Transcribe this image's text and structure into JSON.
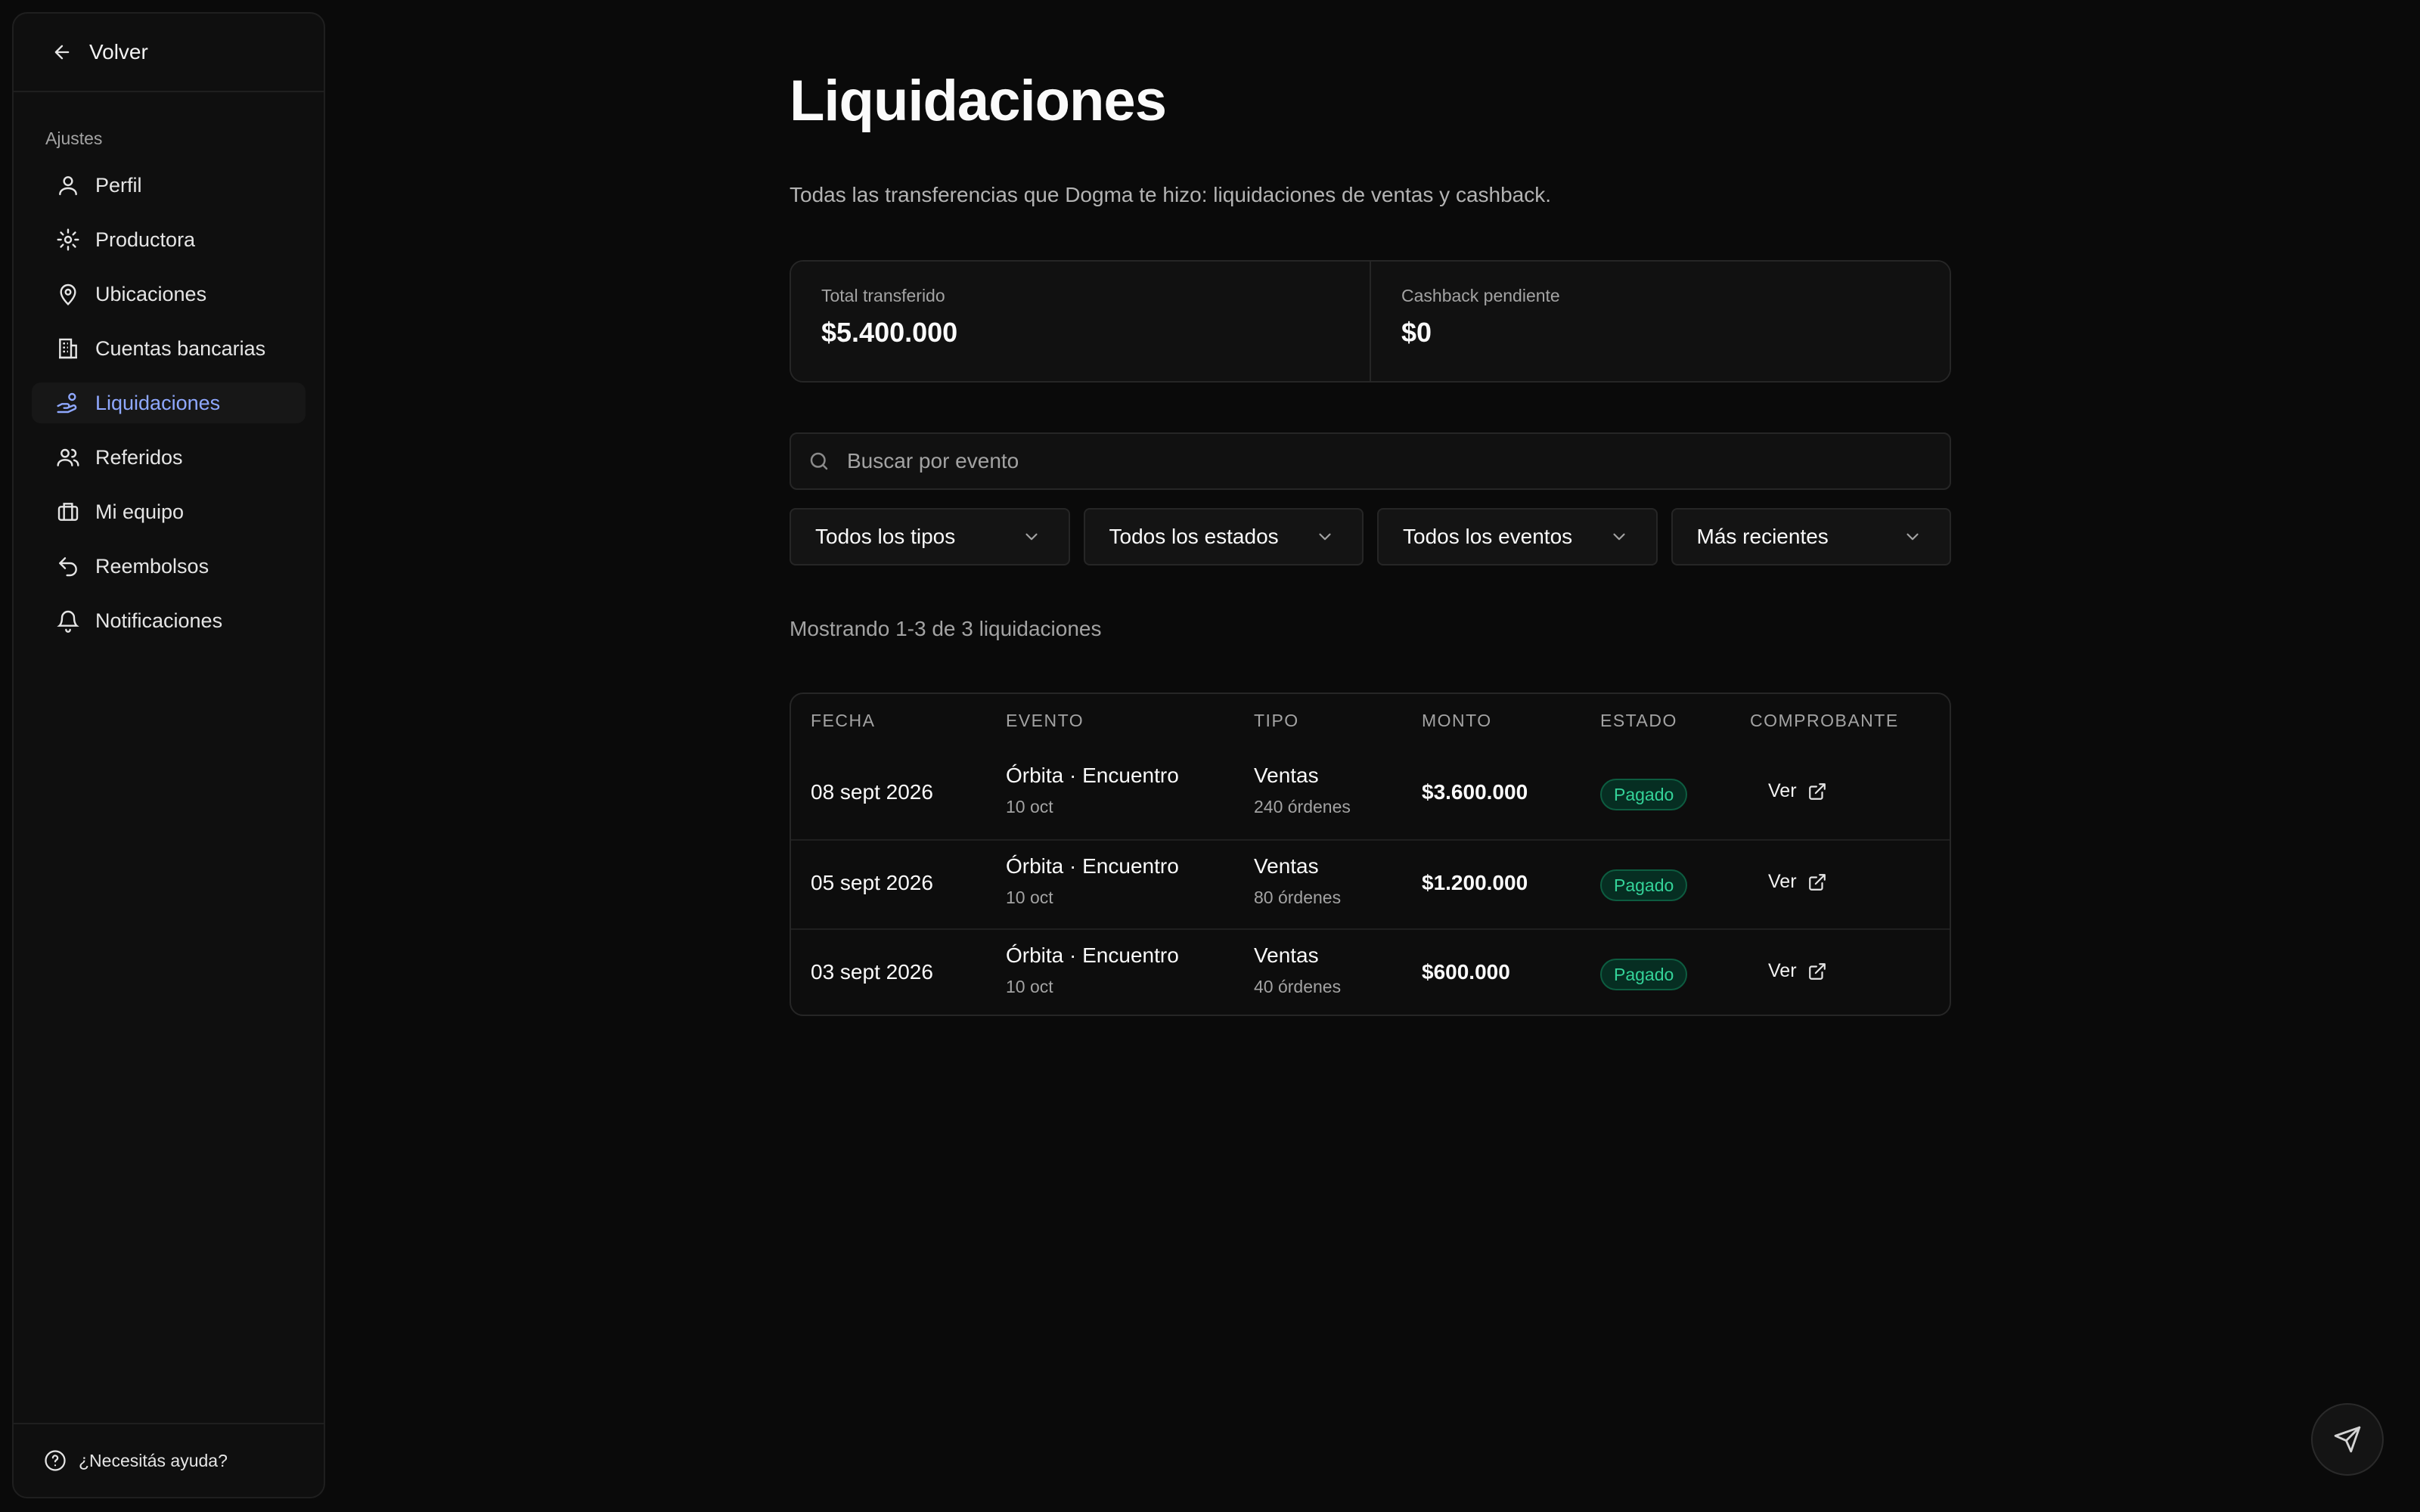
{
  "sidebar": {
    "back_label": "Volver",
    "section_label": "Ajustes",
    "items": [
      {
        "label": "Perfil"
      },
      {
        "label": "Productora"
      },
      {
        "label": "Ubicaciones"
      },
      {
        "label": "Cuentas bancarias"
      },
      {
        "label": "Liquidaciones",
        "active": true
      },
      {
        "label": "Referidos"
      },
      {
        "label": "Mi equipo"
      },
      {
        "label": "Reembolsos"
      },
      {
        "label": "Notificaciones"
      }
    ],
    "help_label": "¿Necesitás ayuda?"
  },
  "page": {
    "title": "Liquidaciones",
    "subtitle": "Todas las transferencias que Dogma te hizo: liquidaciones de ventas y cashback."
  },
  "stats": [
    {
      "label": "Total transferido",
      "value": "$5.400.000"
    },
    {
      "label": "Cashback pendiente",
      "value": "$0"
    }
  ],
  "search": {
    "placeholder": "Buscar por evento"
  },
  "filters": [
    {
      "label": "Todos los tipos"
    },
    {
      "label": "Todos los estados"
    },
    {
      "label": "Todos los eventos"
    },
    {
      "label": "Más recientes"
    }
  ],
  "results_count": "Mostrando 1-3 de 3 liquidaciones",
  "table": {
    "headers": [
      "FECHA",
      "EVENTO",
      "TIPO",
      "MONTO",
      "ESTADO",
      "COMPROBANTE"
    ],
    "rows": [
      {
        "date": "08 sept 2026",
        "event": "Órbita · Encuentro",
        "event_date": "10 oct",
        "type": "Ventas",
        "orders": "240 órdenes",
        "amount": "$3.600.000",
        "status": "Pagado",
        "receipt": "Ver"
      },
      {
        "date": "05 sept 2026",
        "event": "Órbita · Encuentro",
        "event_date": "10 oct",
        "type": "Ventas",
        "orders": "80 órdenes",
        "amount": "$1.200.000",
        "status": "Pagado",
        "receipt": "Ver"
      },
      {
        "date": "03 sept 2026",
        "event": "Órbita · Encuentro",
        "event_date": "10 oct",
        "type": "Ventas",
        "orders": "40 órdenes",
        "amount": "$600.000",
        "status": "Pagado",
        "receipt": "Ver"
      }
    ]
  },
  "colors": {
    "background": "#0a0a0a",
    "accent": "#8fa8ff",
    "success": "#34d399"
  }
}
